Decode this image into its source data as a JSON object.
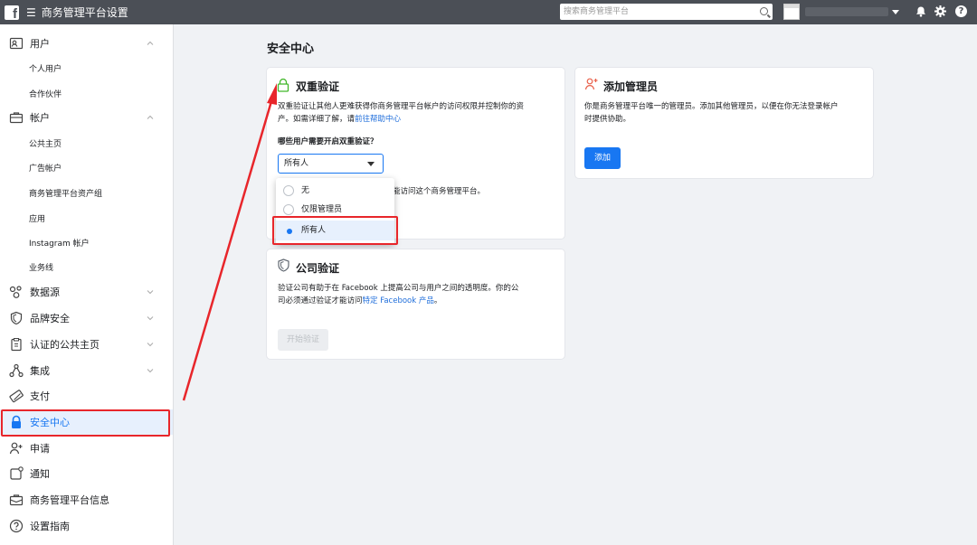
{
  "app": {
    "title": "商务管理平台设置"
  },
  "topbar": {
    "search_placeholder": "搜索商务管理平台",
    "help_glyph": "?"
  },
  "sidebar": {
    "users": {
      "label": "用户",
      "sub": [
        "个人用户",
        "合作伙伴"
      ]
    },
    "accounts": {
      "label": "帐户",
      "sub": [
        "公共主页",
        "广告帐户",
        "商务管理平台资产组",
        "应用",
        "Instagram 帐户",
        "业务线"
      ]
    },
    "items": [
      "数据源",
      "品牌安全",
      "认证的公共主页",
      "集成",
      "支付",
      "安全中心",
      "申请",
      "通知",
      "商务管理平台信息",
      "设置指南"
    ]
  },
  "main": {
    "page_title": "安全中心",
    "two_factor": {
      "title": "双重验证",
      "desc_1": "双重验证让其他人更难获得你商务管理平台帐户的访问权限并控制你的资",
      "desc_2": "产。如需详细了解，请",
      "link": "前往帮助中心",
      "question": "哪些用户需要开启双重验证？",
      "selected": "所有人",
      "hidden_text": "能访问这个商务管理平台。",
      "options": [
        "无",
        "仅限管理员",
        "所有人"
      ]
    },
    "add_admin": {
      "title": "添加管理员",
      "desc_1": "你是商务管理平台唯一的管理员。添加其他管理员，以便在你无法登录帐户",
      "desc_2": "时提供协助。",
      "button": "添加"
    },
    "company": {
      "title": "公司验证",
      "desc_1": "验证公司有助于在 Facebook 上提高公司与用户之间的透明度。你的公",
      "desc_2": "司必须通过验证才能访问",
      "link": "特定 Facebook 产品",
      "desc_end": "。",
      "button": "开始验证"
    }
  },
  "colors": {
    "accent": "#1877f2",
    "annotation": "#e8262b",
    "topbar": "#4b4f56"
  }
}
